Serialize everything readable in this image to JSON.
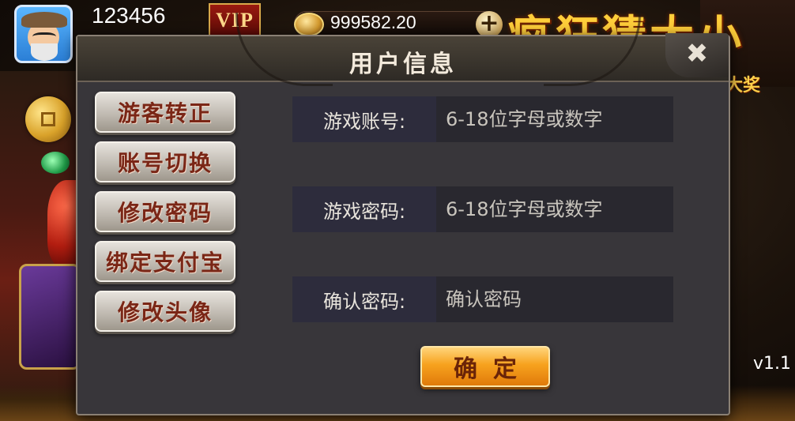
{
  "player": {
    "id": "123456",
    "vip_label": "VIP",
    "coins": "999582.20",
    "add_coins_symbol": "+"
  },
  "background": {
    "banner_title": "疯狂猜大小",
    "banner_sub": "大奖",
    "version": "v1.1"
  },
  "dialog": {
    "title": "用户信息",
    "close_symbol": "✖",
    "menu": [
      {
        "label": "游客转正"
      },
      {
        "label": "账号切换"
      },
      {
        "label": "修改密码"
      },
      {
        "label": "绑定支付宝"
      },
      {
        "label": "修改头像"
      }
    ],
    "fields": [
      {
        "label": "游戏账号:",
        "value": "",
        "placeholder": "6-18位字母或数字"
      },
      {
        "label": "游戏密码:",
        "value": "",
        "placeholder": "6-18位字母或数字"
      },
      {
        "label": "确认密码:",
        "value": "",
        "placeholder": "确认密码"
      }
    ],
    "confirm_label": "确定"
  },
  "colors": {
    "accent_gold": "#f7a21e",
    "menu_text": "#7a2616",
    "dialog_bg": "#38363a"
  },
  "icons": [
    "avatar-icon",
    "coin-icon",
    "plus-icon",
    "close-icon",
    "vip-icon"
  ]
}
